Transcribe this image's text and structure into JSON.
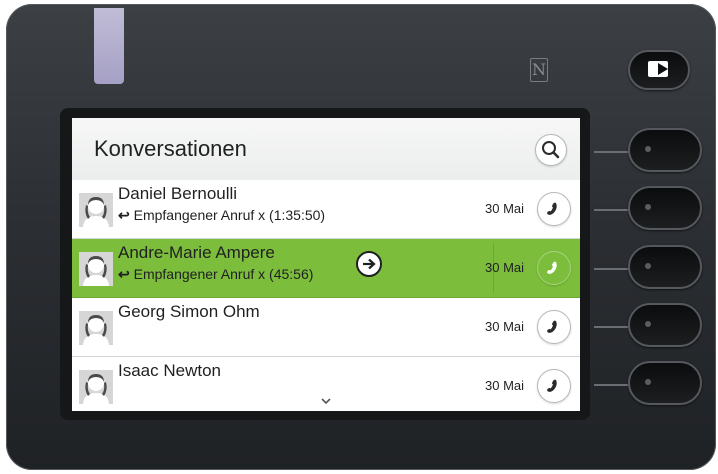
{
  "header": {
    "title": "Konversationen",
    "search_icon": "search-icon"
  },
  "conversations": [
    {
      "name": "Daniel Bernoulli",
      "detail": "Empfangener Anruf x (1:35:50)",
      "date": "30 Mai",
      "selected": false
    },
    {
      "name": "Andre-Marie Ampere",
      "detail": "Empfangener Anruf x (45:56)",
      "date": "30 Mai",
      "selected": true
    },
    {
      "name": "Georg Simon Ohm",
      "detail": "",
      "date": "30 Mai",
      "selected": false
    },
    {
      "name": "Isaac Newton",
      "detail": "",
      "date": "30 Mai",
      "selected": false
    }
  ],
  "colors": {
    "selected_row": "#7cbd3c",
    "device_body": "#2c2f33",
    "led": "#c8c2e8"
  },
  "icons": {
    "call": "phone-icon",
    "missed_call": "incoming-call-icon",
    "forward": "arrow-right-icon",
    "scroll_more": "chevron-down-icon",
    "exit": "exit-icon",
    "nfc": "nfc-icon"
  }
}
